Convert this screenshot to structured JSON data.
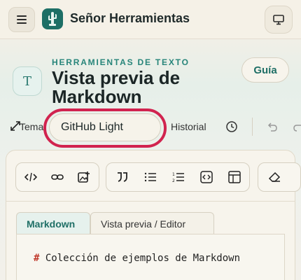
{
  "app": {
    "title": "Señor Herramientas",
    "logo_icon": "cactus-icon",
    "accent": "#1d6f66"
  },
  "header": {
    "eyebrow": "HERRAMIENTAS DE TEXTO",
    "title": "Vista previa de Markdown",
    "tool_icon_letter": "T",
    "guide_label": "Guía"
  },
  "controls": {
    "theme_label": "Tema",
    "theme_value": "GitHub Light",
    "history_label": "Historial",
    "highlight_color": "#d1234f"
  },
  "toolbar": {
    "groups": [
      [
        "code-icon",
        "link-icon",
        "image-add-icon"
      ],
      [
        "quote-icon",
        "bullet-list-icon",
        "numbered-list-icon",
        "code-block-icon",
        "table-icon"
      ],
      [
        "eraser-icon"
      ]
    ]
  },
  "tabs": [
    {
      "label": "Markdown",
      "active": true
    },
    {
      "label": "Vista previa / Editor",
      "active": false
    }
  ],
  "editor": {
    "first_line_hash": "#",
    "first_line_text": "Colección de ejemplos de Markdown"
  }
}
